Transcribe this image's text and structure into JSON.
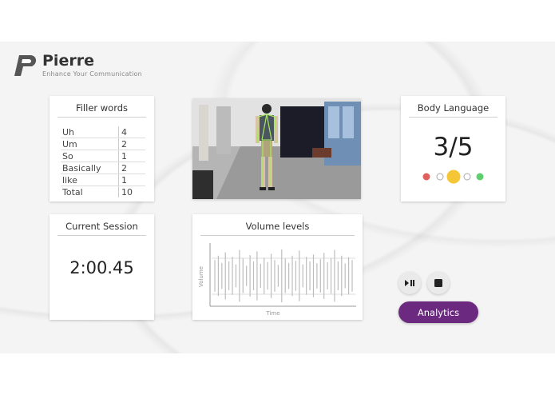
{
  "brand": {
    "name": "Pierre",
    "tagline": "Enhance Your Communication"
  },
  "filler": {
    "title": "Filler words",
    "rows": [
      {
        "word": "Uh",
        "count": "4"
      },
      {
        "word": "Um",
        "count": "2"
      },
      {
        "word": "So",
        "count": "1"
      },
      {
        "word": "Basically",
        "count": "2"
      },
      {
        "word": "like",
        "count": "1"
      },
      {
        "word": "Total",
        "count": "10"
      }
    ]
  },
  "body_language": {
    "title": "Body Language",
    "score": "3/5",
    "scale_colors": [
      "#e0605c",
      "#ffffff",
      "#f5c636",
      "#ffffff",
      "#5fcf6e"
    ],
    "selected_level": 3
  },
  "session": {
    "title": "Current Session",
    "time": "2:00.45"
  },
  "volume": {
    "title": "Volume levels",
    "xlabel": "Time",
    "ylabel": "Volume",
    "level_bars": [
      0.55,
      0.7,
      0.45,
      0.82,
      0.5,
      0.66,
      0.4,
      0.9,
      0.6,
      0.35,
      0.72,
      0.5,
      0.85,
      0.42,
      0.63,
      0.48,
      0.77,
      0.55,
      0.38,
      0.92,
      0.6,
      0.45,
      0.7,
      0.52,
      0.88,
      0.4,
      0.66,
      0.5,
      0.74,
      0.44,
      0.58,
      0.8,
      0.47,
      0.62,
      0.9,
      0.5,
      0.7,
      0.43,
      0.65,
      0.55
    ],
    "line_color": "#bdbdbd"
  },
  "controls": {
    "play_pause_icon": "play-pause-icon",
    "stop_icon": "stop-icon",
    "analytics_label": "Analytics",
    "accent": "#6b2a7f"
  },
  "video": {
    "skeleton_color": "#a8e85c"
  }
}
